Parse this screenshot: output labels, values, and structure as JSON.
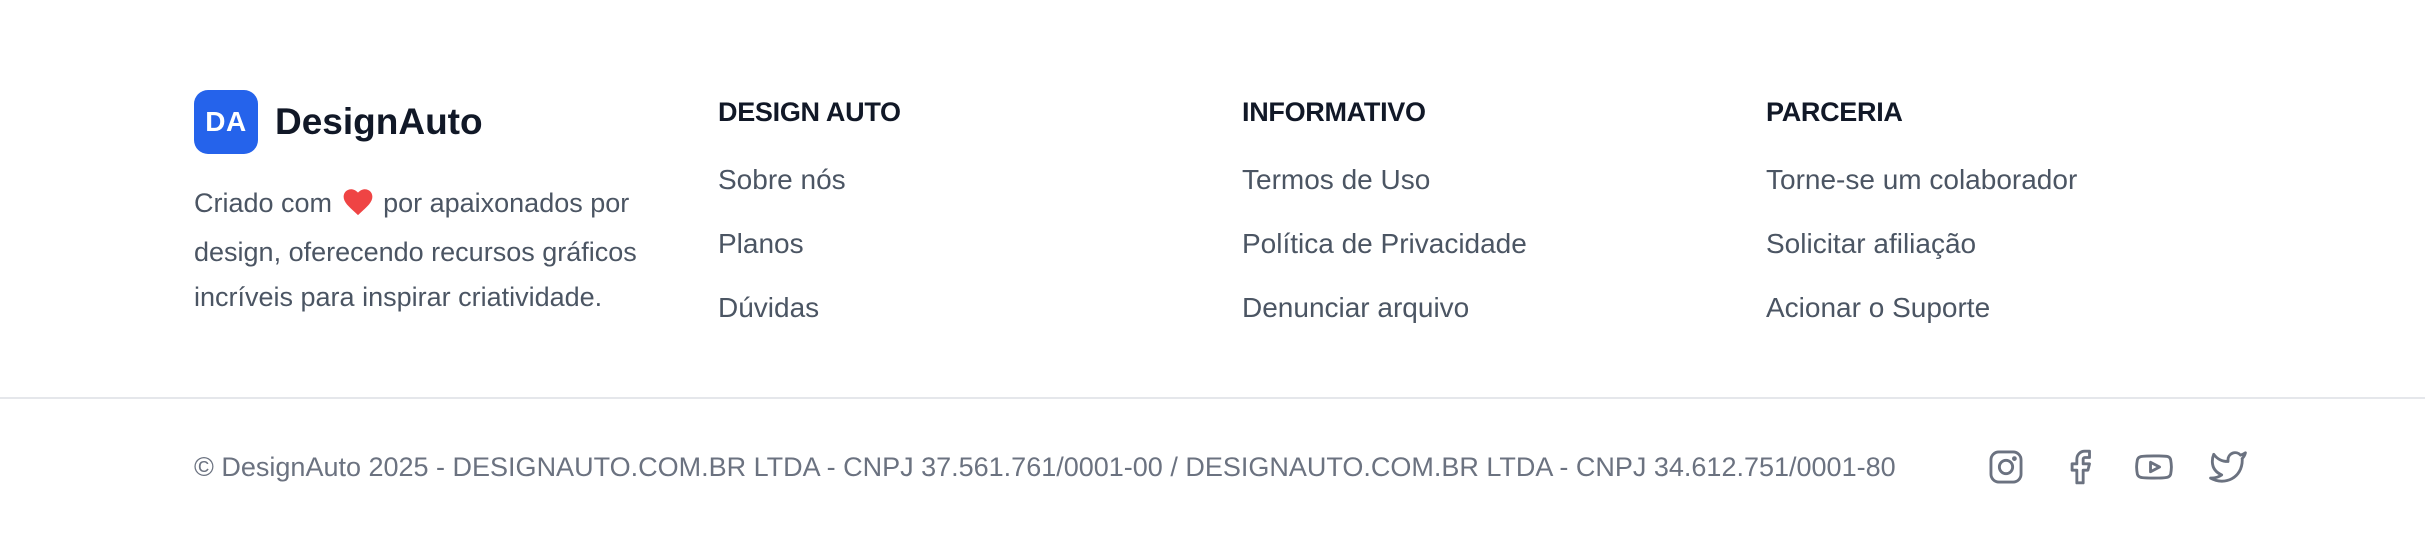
{
  "brand": {
    "logo_text": "DA",
    "name": "DesignAuto",
    "tagline_before": "Criado com",
    "tagline_after": "por apaixonados por design, oferecendo recursos gráficos incríveis para inspirar criatividade.",
    "accent_color": "#2563eb",
    "heart_color": "#ef4444"
  },
  "columns": [
    {
      "title": "DESIGN AUTO",
      "links": [
        "Sobre nós",
        "Planos",
        "Dúvidas"
      ]
    },
    {
      "title": "INFORMATIVO",
      "links": [
        "Termos de Uso",
        "Política de Privacidade",
        "Denunciar arquivo"
      ]
    },
    {
      "title": "PARCERIA",
      "links": [
        "Torne-se um colaborador",
        "Solicitar afiliação",
        "Acionar o Suporte"
      ]
    }
  ],
  "copyright": "© DesignAuto 2025 - DESIGNAUTO.COM.BR LTDA - CNPJ 37.561.761/0001-00 / DESIGNAUTO.COM.BR LTDA - CNPJ 34.612.751/0001-80",
  "socials": [
    "instagram-icon",
    "facebook-icon",
    "youtube-icon",
    "twitter-icon"
  ]
}
